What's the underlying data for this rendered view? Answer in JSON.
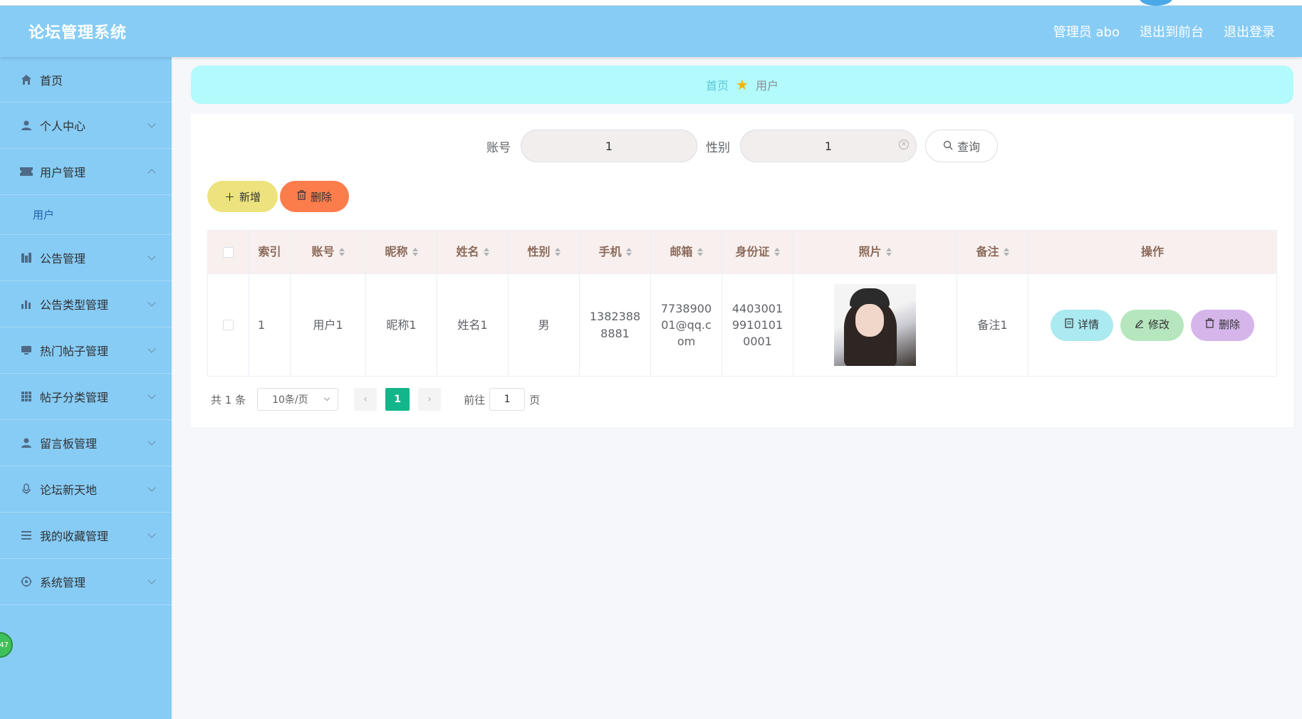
{
  "header": {
    "title": "论坛管理系统",
    "admin_label": "管理员 abo",
    "exit_front": "退出到前台",
    "logout": "退出登录"
  },
  "sidebar": {
    "items": [
      {
        "label": "首页",
        "icon": "home-icon"
      },
      {
        "label": "个人中心",
        "icon": "user-icon"
      },
      {
        "label": "用户管理",
        "icon": "ticket-icon",
        "sub": "用户"
      },
      {
        "label": "公告管理",
        "icon": "chart-icon"
      },
      {
        "label": "公告类型管理",
        "icon": "bar-chart-icon"
      },
      {
        "label": "热门帖子管理",
        "icon": "monitor-icon"
      },
      {
        "label": "帖子分类管理",
        "icon": "grid-icon"
      },
      {
        "label": "留言板管理",
        "icon": "user-icon"
      },
      {
        "label": "论坛新天地",
        "icon": "mic-icon"
      },
      {
        "label": "我的收藏管理",
        "icon": "list-icon"
      },
      {
        "label": "系统管理",
        "icon": "gear-icon"
      }
    ],
    "float_badge": "47"
  },
  "breadcrumb": {
    "home": "首页",
    "current": "用户"
  },
  "search": {
    "account_label": "账号",
    "account_value": "1",
    "gender_label": "性别",
    "gender_value": "1",
    "query_button": "查询"
  },
  "actions": {
    "add": "新增",
    "delete": "删除"
  },
  "table": {
    "columns": [
      "索引",
      "账号",
      "昵称",
      "姓名",
      "性别",
      "手机",
      "邮箱",
      "身份证",
      "照片",
      "备注",
      "操作"
    ],
    "rows": [
      {
        "index": "1",
        "account": "用户1",
        "nickname": "昵称1",
        "name": "姓名1",
        "gender": "男",
        "phone": "13823888881",
        "email": "773890001@qq.com",
        "id_card": "440300199101010001",
        "remark": "备注1",
        "ops": {
          "detail": "详情",
          "edit": "修改",
          "delete": "删除"
        }
      }
    ]
  },
  "pagination": {
    "total": "共 1 条",
    "page_size": "10条/页",
    "current_page": "1",
    "goto_label": "前往",
    "goto_value": "1",
    "page_suffix": "页"
  },
  "colors": {
    "header_bg": "#87ccf5",
    "breadcrumb_bg": "#b3fafc",
    "add_btn": "#ede37e",
    "delete_btn": "#fb7d4c",
    "page_active": "#13b58a"
  }
}
